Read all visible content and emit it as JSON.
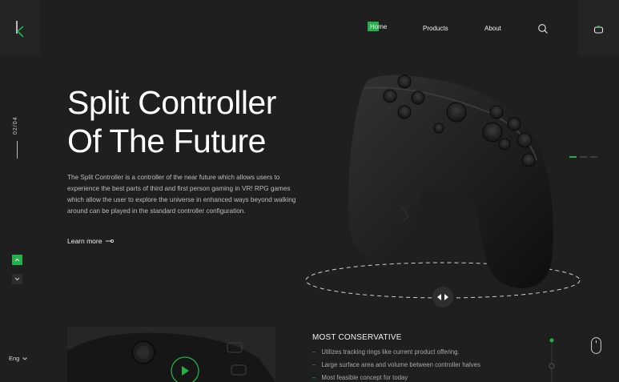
{
  "brand": {
    "logo_letter": "k"
  },
  "nav": {
    "home": "Home",
    "products": "Products",
    "about": "About"
  },
  "slider": {
    "position": "02/04"
  },
  "hero": {
    "title_line1": "Split Controller",
    "title_line2": "Of The Future",
    "description": "The Split Controller is a controller of the near future which allows users to experience the best parts of third and first person gaming in VR! RPG games which allow the user to explore the universe in enhanced ways beyond walking around can be played in the standard controller configuration.",
    "learn_more": "Learn more"
  },
  "language": {
    "current": "Eng"
  },
  "features": {
    "heading": "MOST CONSERVATIVE",
    "items": [
      "Utilizes tracking rings like current product offering.",
      "Large surface area and volume between controller halves",
      "Most feasible concept for today"
    ]
  },
  "colors": {
    "accent": "#22b04b",
    "background": "#1f1f1f",
    "panel": "#242424"
  },
  "icons": [
    "logo-icon",
    "search-icon",
    "cart-icon",
    "arrow-up-icon",
    "arrow-down-icon",
    "arrow-right-icon",
    "rotate-icon",
    "play-icon",
    "mouse-scroll-icon",
    "chevron-down-icon"
  ]
}
